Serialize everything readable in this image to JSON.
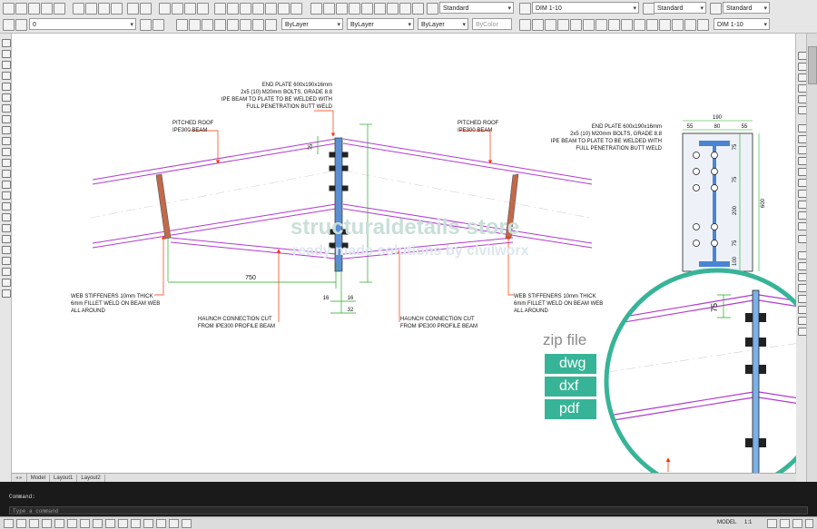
{
  "toolbar": {
    "layer_value": "0",
    "color_value": "ByLayer",
    "linetype_value": "ByLayer",
    "lineweight_value": "ByLayer",
    "plotstyle_value": "ByColor",
    "text_style": "Standard",
    "dim_style": "DIM 1-10",
    "table_style": "Standard",
    "mleader_style": "Standard",
    "dim_scale": "DIM 1-10"
  },
  "drawing": {
    "end_plate_note": [
      "END PLATE 600x190x16mm",
      "2x5 (10) M20mm BOLTS, GRADE 8.8",
      "IPE BEAM TO PLATE TO BE WELDED WITH",
      "FULL PENETRATION BUTT WELD"
    ],
    "pitched_roof_left": [
      "PITCHED ROOF",
      "IPE300 BEAM"
    ],
    "pitched_roof_right": [
      "PITCHED ROOF",
      "IPE300 BEAM"
    ],
    "web_stiffeners_left": [
      "WEB STIFFENERS 10mm THICK",
      "6mm FILLET WELD ON BEAM WEB",
      "ALL AROUND"
    ],
    "web_stiffeners_right": [
      "WEB STIFFENERS 10mm THICK",
      "6mm FILLET WELD ON BEAM WEB",
      "ALL AROUND"
    ],
    "haunch_left": [
      "HAUNCH CONNECTION CUT",
      "FROM IPE300 PROFILE BEAM"
    ],
    "haunch_right": [
      "HAUNCH CONNECTION CUT",
      "FROM IPE300 PROFILE BEAM"
    ],
    "plate_note": [
      "END PLATE 600x190x16mm",
      "2x5 (10) M20mm BOLTS, GRADE 8.8",
      "IPE BEAM TO PLATE TO BE WELDED WITH",
      "FULL PENETRATION BUTT WELD"
    ],
    "dims": {
      "d750": "750",
      "d16a": "16",
      "d16b": "16",
      "d32": "32",
      "d75": "75",
      "plate_width": "190",
      "p55a": "55",
      "p80": "80",
      "p55b": "55",
      "p75a": "75",
      "p75b": "75",
      "p200": "200",
      "p75c": "75",
      "p100": "100",
      "p600": "600",
      "zoom75": "75"
    },
    "watermark_main": "structuraldetails store",
    "watermark_sub": "ready made solutions by civilworx"
  },
  "files": {
    "label": "zip file",
    "formats": [
      "dwg",
      "dxf",
      "pdf"
    ],
    "accent": "#37b497"
  },
  "layout_tabs": [
    "Model",
    "Layout1",
    "Layout2"
  ],
  "command": {
    "history": "Command:",
    "placeholder": "Type a command"
  },
  "status": {
    "model": "MODEL",
    "scale": "1:1"
  }
}
